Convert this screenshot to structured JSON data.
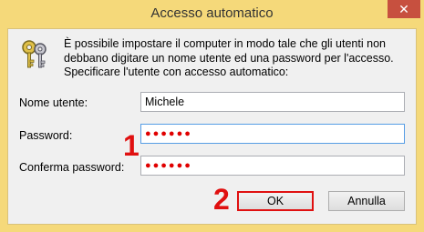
{
  "window": {
    "title": "Accesso automatico",
    "close_glyph": "✕"
  },
  "dialog": {
    "icon": "keys-icon",
    "description_lines": [
      "È possibile impostare il computer in modo tale che gli utenti non",
      "debbano digitare un nome utente ed una password per l'accesso.",
      "Specificare l'utente con accesso automatico:"
    ],
    "username": {
      "label": "Nome utente:",
      "value": "Michele"
    },
    "password": {
      "label": "Password:",
      "masked": "●●●●●●"
    },
    "confirm": {
      "label": "Conferma password:",
      "masked": "●●●●●●"
    },
    "ok_label": "OK",
    "cancel_label": "Annulla"
  },
  "annotations": {
    "marker_1": "1",
    "marker_2": "2",
    "highlight_color": "#e01010"
  }
}
